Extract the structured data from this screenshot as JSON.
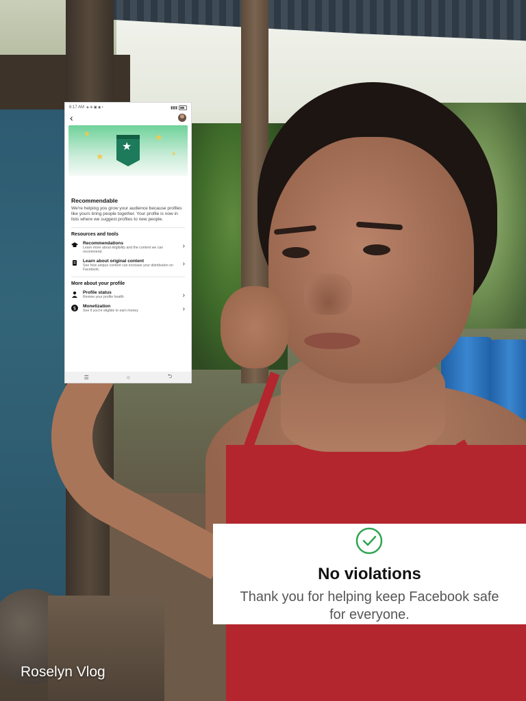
{
  "phone": {
    "status_time": "6:17 AM",
    "status_icons_left": "◈ ⊕ ▣ ◉ •",
    "hero_title": "Recommendable",
    "hero_desc": "We're helping you grow your audience because profiles like yours bring people together. Your profile is now in lists where we suggest profiles to new people.",
    "resources_title": "Resources and tools",
    "resources": [
      {
        "title": "Recommendations",
        "subtitle": "Learn more about eligibility and the content we can recommend."
      },
      {
        "title": "Learn about original content",
        "subtitle": "See how unique content can increase your distribution on Facebook."
      }
    ],
    "profile_title": "More about your profile",
    "profile_items": [
      {
        "title": "Profile status",
        "subtitle": "Review your profile health"
      },
      {
        "title": "Monetization",
        "subtitle": "See if you're eligible to earn money"
      }
    ]
  },
  "notice": {
    "title": "No violations",
    "message_line1": "Thank you for helping keep Facebook safe",
    "message_line2": "for everyone."
  },
  "watermark": "Roselyn Vlog",
  "colors": {
    "check_green": "#2ea44f",
    "badge_green": "#1d7a5a",
    "star_yellow": "#f2c94c",
    "top_red": "#b3262d"
  },
  "icons": [
    "back-arrow-icon",
    "avatar",
    "graduation-cap-icon",
    "document-icon",
    "person-icon",
    "dollar-icon",
    "chevron-right-icon",
    "menu-icon",
    "home-circle-icon",
    "back-icon",
    "check-circle-icon",
    "star-icon"
  ]
}
